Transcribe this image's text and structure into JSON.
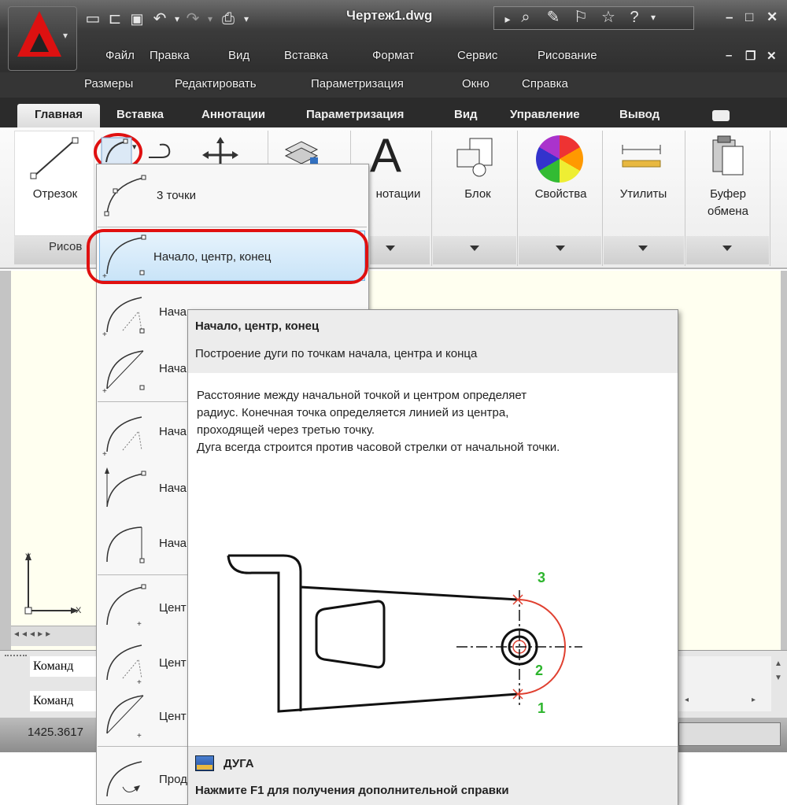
{
  "window": {
    "title": "Чертеж1.dwg"
  },
  "menu": {
    "row1": [
      "Файл",
      "Правка",
      "Вид",
      "Вставка",
      "Формат",
      "Сервис",
      "Рисование"
    ],
    "row2": [
      "Размеры",
      "Редактировать",
      "Параметризация",
      "Окно",
      "Справка"
    ]
  },
  "ribbon": {
    "tabs": [
      "Главная",
      "Вставка",
      "Аннотации",
      "Параметризация",
      "Вид",
      "Управление",
      "Вывод"
    ],
    "line_label": "Отрезок",
    "draw_panel_label": "Рисов",
    "annotation_label": "нотации",
    "block_label": "Блок",
    "properties_label": "Свойства",
    "utilities_label": "Утилиты",
    "clipboard_label_1": "Буфер",
    "clipboard_label_2": "обмена"
  },
  "dropdown": {
    "items": [
      "3 точки",
      "Начало, центр, конец",
      "Нача",
      "Нача",
      "Нача",
      "Нача",
      "Нача",
      "Цент",
      "Цент",
      "Цент",
      "Прод"
    ]
  },
  "tooltip": {
    "title": "Начало, центр, конец",
    "summary": "Построение дуги по точкам начала, центра и конца",
    "desc_1": "Расстояние между начальной точкой и центром определяет",
    "desc_2": "радиус. Конечная точка определяется линией из центра,",
    "desc_3": "проходящей через третью точку.",
    "desc_4": "Дуга всегда строится против часовой стрелки от начальной точки.",
    "command": "ДУГА",
    "help": "Нажмите F1 для получения дополнительной справки",
    "point_labels": [
      "3",
      "2",
      "1"
    ]
  },
  "command_line": {
    "line1": "Команд",
    "line2": "Команд"
  },
  "status": {
    "coords": "1425.3617"
  },
  "axes": {
    "y": "Y",
    "x": "X"
  },
  "colors": {
    "highlight": "#e01010",
    "point_label": "#2db52d",
    "arc": "#e04030"
  }
}
